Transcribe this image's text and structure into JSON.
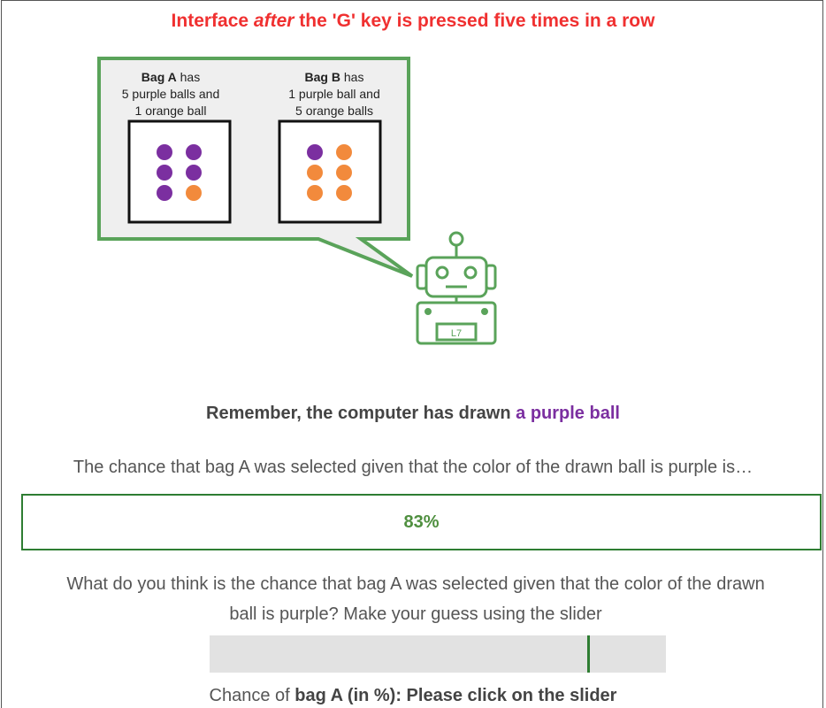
{
  "heading": {
    "prefix": "Interface ",
    "emphasis": "after",
    "suffix": " the 'G' key is pressed five times in a row"
  },
  "bags": [
    {
      "name": "Bag A",
      "has": " has",
      "line2": "5 purple balls and",
      "line3": "1 orange ball",
      "balls": [
        "purple",
        "purple",
        "purple",
        "purple",
        "purple",
        "orange"
      ]
    },
    {
      "name": "Bag B",
      "has": " has",
      "line2": "1 purple ball and",
      "line3": "5 orange balls",
      "balls": [
        "purple",
        "orange",
        "orange",
        "orange",
        "orange",
        "orange"
      ]
    }
  ],
  "robot": {
    "label": "L7"
  },
  "colors": {
    "heading": "#f03030",
    "green": "#5aa35a",
    "dark_green": "#2e7d32",
    "purple": "#7b2fa0",
    "orange": "#f28a3c",
    "bubble_bg": "#efefef"
  },
  "remember": {
    "prefix": "Remember, the computer has drawn ",
    "highlight": "a purple ball"
  },
  "question1": "The chance that bag A was selected given that the color of the drawn ball is purple is…",
  "answer": "83%",
  "question2": {
    "line1": "What do you think is the chance that bag A was selected given that the color of the drawn",
    "line2": "ball is purple? Make your guess using the slider"
  },
  "slider": {
    "value_percent": 83
  },
  "slider_caption": {
    "prefix": "Chance of ",
    "bold": "bag A (in %): Please click on the slider"
  }
}
